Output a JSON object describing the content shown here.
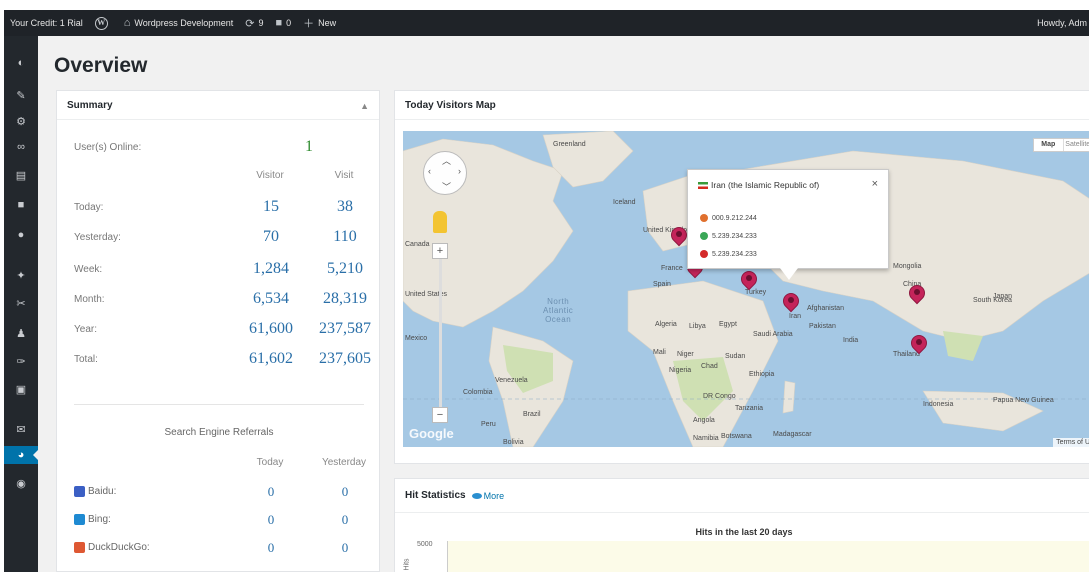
{
  "adminbar": {
    "credit": "Your Credit: 1 Rial",
    "site_name": "Wordpress Development",
    "updates_count": "9",
    "comments_count": "0",
    "new_label": "New",
    "howdy": "Howdy, Adm"
  },
  "page": {
    "title": "Overview"
  },
  "sidebar": {
    "icons": [
      "dashboard-icon",
      "pin-icon",
      "sliders-icon",
      "link-icon",
      "pages-icon",
      "comments-icon",
      "circle-icon",
      "appearance-icon",
      "plugins-icon",
      "users-icon",
      "tools-icon",
      "settings-icon",
      "mail-icon",
      "statistics-icon",
      "circle-icon"
    ]
  },
  "summary": {
    "title": "Summary",
    "toggle": "▲",
    "users_online_label": "User(s) Online:",
    "users_online_value": "1",
    "col_visitor": "Visitor",
    "col_visit": "Visit",
    "rows": [
      {
        "label": "Today:",
        "visitor": "15",
        "visit": "38"
      },
      {
        "label": "Yesterday:",
        "visitor": "70",
        "visit": "110"
      },
      {
        "label": "Week:",
        "visitor": "1,284",
        "visit": "5,210"
      },
      {
        "label": "Month:",
        "visitor": "6,534",
        "visit": "28,319"
      },
      {
        "label": "Year:",
        "visitor": "61,600",
        "visit": "237,587"
      },
      {
        "label": "Total:",
        "visitor": "61,602",
        "visit": "237,605"
      }
    ],
    "search_title": "Search Engine Referrals",
    "col_today": "Today",
    "col_yesterday": "Yesterday",
    "engines": [
      {
        "name": "Baidu:",
        "today": "0",
        "yesterday": "0",
        "color": "#3b5fc4"
      },
      {
        "name": "Bing:",
        "today": "0",
        "yesterday": "0",
        "color": "#1e8ad2"
      },
      {
        "name": "DuckDuckGo:",
        "today": "0",
        "yesterday": "0",
        "color": "#de5833"
      }
    ]
  },
  "map": {
    "title": "Today Visitors Map",
    "map_type": [
      "Map",
      "Satellite"
    ],
    "labels": {
      "greenland": "Greenland",
      "iceland": "Iceland",
      "canada": "Canada",
      "united_states": "United States",
      "mexico": "Mexico",
      "colombia": "Colombia",
      "venezuela": "Venezuela",
      "peru": "Peru",
      "brazil": "Brazil",
      "bolivia": "Bolivia",
      "united_kingdom": "United Kingdom",
      "spain": "Spain",
      "france": "France",
      "turkey": "Turkey",
      "iran": "Iran",
      "afghanistan": "Afghanistan",
      "pakistan": "Pakistan",
      "india": "India",
      "china": "China",
      "mongolia": "Mongolia",
      "south_korea": "South Korea",
      "japan": "Japan",
      "thailand": "Thailand",
      "indonesia": "Indonesia",
      "papua": "Papua New Guinea",
      "algeria": "Algeria",
      "libya": "Libya",
      "egypt": "Egypt",
      "saudi": "Saudi Arabia",
      "mali": "Mali",
      "niger": "Niger",
      "chad": "Chad",
      "sudan": "Sudan",
      "ethiopia": "Ethiopia",
      "nigeria": "Nigeria",
      "dr_congo": "DR Congo",
      "tanzania": "Tanzania",
      "angola": "Angola",
      "namibia": "Namibia",
      "botswana": "Botswana",
      "madagascar": "Madagascar"
    },
    "ocean": "North\nAtlantic\nOcean",
    "google": "Google",
    "terms": "Terms of U",
    "infowindow": {
      "title": "Iran (the Islamic Republic of)",
      "close": "×",
      "ips": [
        "000.9.212.244",
        "5.239.234.233",
        "5.239.234.233"
      ],
      "ip_colors": [
        "#e0702e",
        "#3aa757",
        "#d42a2a"
      ]
    }
  },
  "hits": {
    "title": "Hit Statistics",
    "more": "More",
    "chart_title": "Hits in the last 20 days",
    "ytick_top": "5000",
    "ylabel": "Hits"
  }
}
